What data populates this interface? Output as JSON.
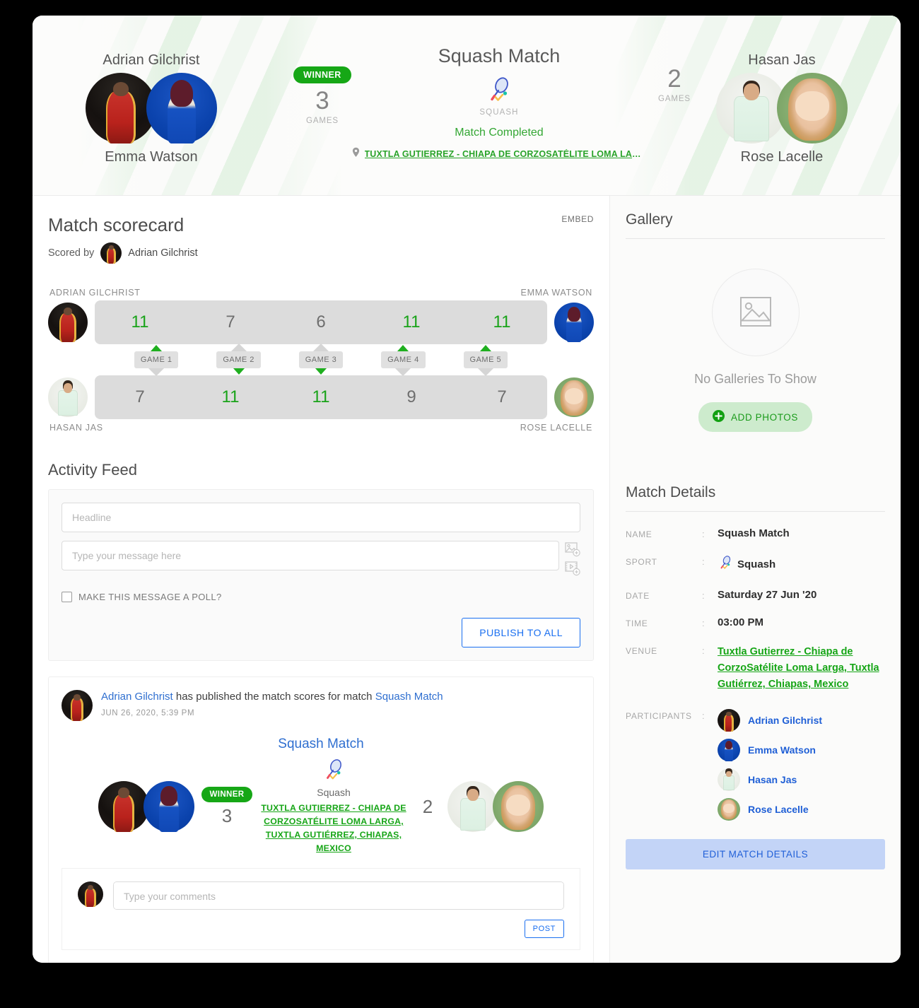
{
  "header": {
    "title": "Squash Match",
    "sport_label": "SQUASH",
    "sport_icon": "squash-racket-icon",
    "status": "Match Completed",
    "venue_short": "TUXTLA GUTIERREZ - CHIAPA DE CORZOSATÉLITE LOMA LARG...",
    "location_icon": "map-pin-icon",
    "winner_badge": "WINNER",
    "left_team": {
      "top_name": "Adrian Gilchrist",
      "bottom_name": "Emma Watson",
      "games": "3",
      "games_label": "GAMES"
    },
    "right_team": {
      "top_name": "Hasan Jas",
      "bottom_name": "Rose Lacelle",
      "games": "2",
      "games_label": "GAMES"
    }
  },
  "scorecard": {
    "title": "Match scorecard",
    "embed_label": "EMBED",
    "scored_by_label": "Scored by",
    "scored_by_name": "Adrian Gilchrist",
    "top_left_name": "ADRIAN GILCHRIST",
    "top_right_name": "EMMA WATSON",
    "bottom_left_name": "HASAN JAS",
    "bottom_right_name": "ROSE LACELLE",
    "games": [
      {
        "label": "GAME 1",
        "top": "11",
        "bottom": "7",
        "winner": "top"
      },
      {
        "label": "GAME 2",
        "top": "7",
        "bottom": "11",
        "winner": "bottom"
      },
      {
        "label": "GAME 3",
        "top": "6",
        "bottom": "11",
        "winner": "bottom"
      },
      {
        "label": "GAME 4",
        "top": "11",
        "bottom": "9",
        "winner": "top"
      },
      {
        "label": "GAME 5",
        "top": "11",
        "bottom": "7",
        "winner": "top"
      }
    ]
  },
  "activity": {
    "title": "Activity Feed",
    "headline_placeholder": "Headline",
    "headline_value": "",
    "message_placeholder": "Type your message here",
    "message_value": "",
    "poll_label": "MAKE THIS MESSAGE A POLL?",
    "poll_checked": false,
    "publish_label": "PUBLISH TO ALL",
    "add_image_icon": "add-image-icon",
    "add_video_icon": "add-video-icon"
  },
  "post": {
    "author": "Adrian Gilchrist",
    "action_text": " has published the match scores for match ",
    "match_link": "Squash Match",
    "timestamp": "JUN 26, 2020, 5:39 PM",
    "match_title": "Squash Match",
    "winner_badge": "WINNER",
    "left_score": "3",
    "right_score": "2",
    "sport_label": "Squash",
    "venue": "TUXTLA GUTIERREZ - CHIAPA DE CORZOSATÉLITE LOMA LARGA, TUXTLA GUTIÉRREZ, CHIAPAS, MEXICO",
    "comment_placeholder": "Type your comments",
    "comment_value": "",
    "post_button": "POST"
  },
  "gallery": {
    "title": "Gallery",
    "empty_text": "No Galleries To Show",
    "empty_icon": "image-placeholder-icon",
    "add_photos_label": "ADD PHOTOS",
    "add_icon": "plus-circle-icon"
  },
  "match_details": {
    "title": "Match Details",
    "rows": [
      {
        "key": "NAME",
        "value": "Squash Match"
      },
      {
        "key": "SPORT",
        "value": "Squash"
      },
      {
        "key": "DATE",
        "value": "Saturday 27 Jun '20"
      },
      {
        "key": "TIME",
        "value": "03:00 PM"
      },
      {
        "key": "VENUE",
        "value": "Tuxtla Gutierrez - Chiapa de CorzoSatélite Loma Larga, Tuxtla Gutiérrez, Chiapas, Mexico"
      }
    ],
    "participants_key": "PARTICIPANTS",
    "participants": [
      "Adrian Gilchrist",
      "Emma Watson",
      "Hasan Jas",
      "Rose Lacelle"
    ],
    "edit_button": "EDIT MATCH DETAILS"
  },
  "colors": {
    "green": "#16a716",
    "link_blue": "#2f6fd0",
    "button_blue": "#1a6ff0",
    "score_bar": "#dcdcdc",
    "text_gray": "#6e6e6e"
  }
}
